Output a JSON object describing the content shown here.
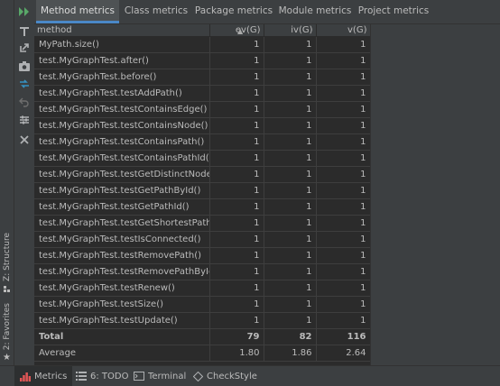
{
  "tabs": [
    "Method metrics",
    "Class metrics",
    "Package metrics",
    "Module metrics",
    "Project metrics"
  ],
  "columns": {
    "method": "method",
    "ev": "ev(G)",
    "iv": "iv(G)",
    "v": "v(G)"
  },
  "rows": [
    {
      "method": "MyPath.size()",
      "ev": "1",
      "iv": "1",
      "v": "1"
    },
    {
      "method": "test.MyGraphTest.after()",
      "ev": "1",
      "iv": "1",
      "v": "1"
    },
    {
      "method": "test.MyGraphTest.before()",
      "ev": "1",
      "iv": "1",
      "v": "1"
    },
    {
      "method": "test.MyGraphTest.testAddPath()",
      "ev": "1",
      "iv": "1",
      "v": "1"
    },
    {
      "method": "test.MyGraphTest.testContainsEdge()",
      "ev": "1",
      "iv": "1",
      "v": "1"
    },
    {
      "method": "test.MyGraphTest.testContainsNode()",
      "ev": "1",
      "iv": "1",
      "v": "1"
    },
    {
      "method": "test.MyGraphTest.testContainsPath()",
      "ev": "1",
      "iv": "1",
      "v": "1"
    },
    {
      "method": "test.MyGraphTest.testContainsPathId()",
      "ev": "1",
      "iv": "1",
      "v": "1"
    },
    {
      "method": "test.MyGraphTest.testGetDistinctNodeCo",
      "ev": "1",
      "iv": "1",
      "v": "1"
    },
    {
      "method": "test.MyGraphTest.testGetPathById()",
      "ev": "1",
      "iv": "1",
      "v": "1"
    },
    {
      "method": "test.MyGraphTest.testGetPathId()",
      "ev": "1",
      "iv": "1",
      "v": "1"
    },
    {
      "method": "test.MyGraphTest.testGetShortestPathLen",
      "ev": "1",
      "iv": "1",
      "v": "1"
    },
    {
      "method": "test.MyGraphTest.testIsConnected()",
      "ev": "1",
      "iv": "1",
      "v": "1"
    },
    {
      "method": "test.MyGraphTest.testRemovePath()",
      "ev": "1",
      "iv": "1",
      "v": "1"
    },
    {
      "method": "test.MyGraphTest.testRemovePathById()",
      "ev": "1",
      "iv": "1",
      "v": "1"
    },
    {
      "method": "test.MyGraphTest.testRenew()",
      "ev": "1",
      "iv": "1",
      "v": "1"
    },
    {
      "method": "test.MyGraphTest.testSize()",
      "ev": "1",
      "iv": "1",
      "v": "1"
    },
    {
      "method": "test.MyGraphTest.testUpdate()",
      "ev": "1",
      "iv": "1",
      "v": "1"
    }
  ],
  "total": {
    "label": "Total",
    "ev": "79",
    "iv": "82",
    "v": "116"
  },
  "average": {
    "label": "Average",
    "ev": "1.80",
    "iv": "1.86",
    "v": "2.64"
  },
  "side_tabs": {
    "structure": "Z: Structure",
    "favorites": "2: Favorites"
  },
  "bottom_tabs": {
    "metrics": "Metrics",
    "todo": "6: TODO",
    "terminal": "Terminal",
    "checkstyle": "CheckStyle"
  },
  "icons": {
    "run": "run-icon",
    "filter": "filter-icon",
    "export": "export-icon",
    "snapshot": "camera-icon",
    "diff": "diff-icon",
    "undo": "undo-icon",
    "settings": "settings-icon",
    "close": "close-icon"
  },
  "colors": {
    "accent": "#4a88c7",
    "background": "#3c3f41",
    "table_bg": "#2b2b2b"
  }
}
